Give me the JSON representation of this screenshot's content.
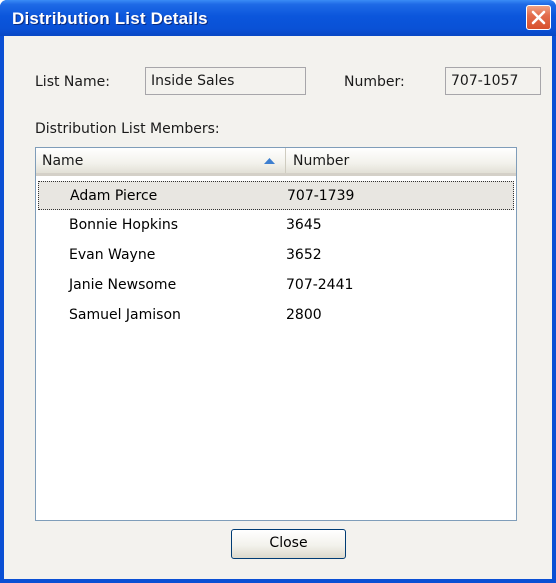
{
  "window": {
    "title": "Distribution List Details",
    "accent_color": "#0a4fd4",
    "close_icon": "close-icon"
  },
  "form": {
    "list_name_label": "List Name:",
    "list_name_value": "Inside Sales",
    "number_label": "Number:",
    "number_value": "707-1057",
    "members_label": "Distribution List Members:"
  },
  "members": {
    "columns": [
      {
        "label": "Name",
        "sort": "ascending"
      },
      {
        "label": "Number"
      }
    ],
    "rows": [
      {
        "name": "Adam Pierce",
        "number": "707-1739",
        "selected": true
      },
      {
        "name": "Bonnie Hopkins",
        "number": "3645"
      },
      {
        "name": "Evan Wayne",
        "number": "3652"
      },
      {
        "name": "Janie Newsome",
        "number": "707-2441"
      },
      {
        "name": "Samuel Jamison",
        "number": "2800"
      }
    ]
  },
  "buttons": {
    "close_label": "Close"
  }
}
